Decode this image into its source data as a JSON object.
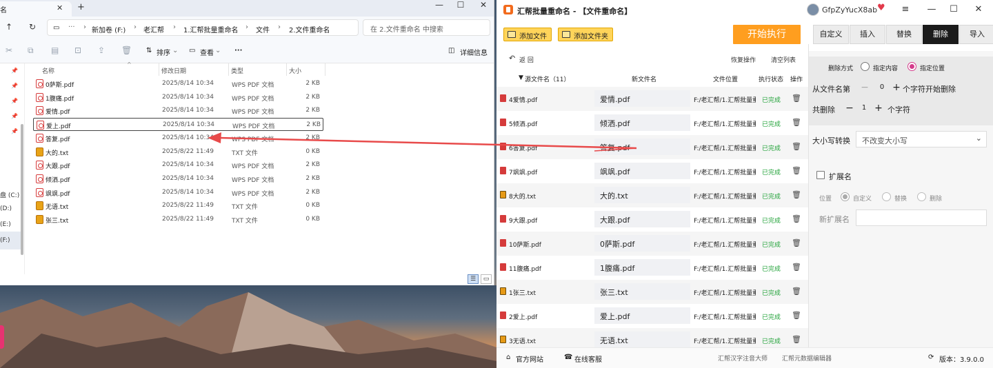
{
  "explorer": {
    "tab_title": "名",
    "crumbs": [
      "新加卷 (F:)",
      "老汇帮",
      "1.汇帮批量重命名",
      "文件",
      "2.文件重命名"
    ],
    "search_placeholder": "在 2.文件重命名 中搜索",
    "toolbar": {
      "sort": "排序",
      "view": "查看",
      "more": "···",
      "details": "详细信息"
    },
    "columns": {
      "name": "名称",
      "date": "修改日期",
      "type": "类型",
      "size": "大小"
    },
    "sidebar": [
      "盘 (C:)",
      "(D:)",
      "(E:)",
      "(F:)"
    ],
    "files": [
      {
        "name": "0萨斯.pdf",
        "date": "2025/8/14 10:34",
        "type": "WPS PDF 文档",
        "size": "2 KB",
        "kind": "pdf"
      },
      {
        "name": "1腹痛.pdf",
        "date": "2025/8/14 10:34",
        "type": "WPS PDF 文档",
        "size": "2 KB",
        "kind": "pdf"
      },
      {
        "name": "爱情.pdf",
        "date": "2025/8/14 10:34",
        "type": "WPS PDF 文档",
        "size": "2 KB",
        "kind": "pdf"
      },
      {
        "name": "爱上.pdf",
        "date": "2025/8/14 10:34",
        "type": "WPS PDF 文档",
        "size": "2 KB",
        "kind": "pdf"
      },
      {
        "name": "答复.pdf",
        "date": "2025/8/14 10:34",
        "type": "WPS PDF 文档",
        "size": "2 KB",
        "kind": "pdf"
      },
      {
        "name": "大的.txt",
        "date": "2025/8/22 11:49",
        "type": "TXT 文件",
        "size": "0 KB",
        "kind": "txt"
      },
      {
        "name": "大跟.pdf",
        "date": "2025/8/14 10:34",
        "type": "WPS PDF 文档",
        "size": "2 KB",
        "kind": "pdf"
      },
      {
        "name": "倾洒.pdf",
        "date": "2025/8/14 10:34",
        "type": "WPS PDF 文档",
        "size": "2 KB",
        "kind": "pdf"
      },
      {
        "name": "飒飒.pdf",
        "date": "2025/8/14 10:34",
        "type": "WPS PDF 文档",
        "size": "2 KB",
        "kind": "pdf"
      },
      {
        "name": "无语.txt",
        "date": "2025/8/22 11:49",
        "type": "TXT 文件",
        "size": "0 KB",
        "kind": "txt"
      },
      {
        "name": "张三.txt",
        "date": "2025/8/22 11:49",
        "type": "TXT 文件",
        "size": "0 KB",
        "kind": "txt"
      }
    ]
  },
  "app": {
    "title": "汇帮批量重命名 - 【文件重命名】",
    "user": "GfpZyYucX8ab",
    "add_file": "添加文件",
    "add_folder": "添加文件夹",
    "start": "开始执行",
    "tabs": [
      "自定义",
      "插入",
      "替换",
      "删除",
      "导入"
    ],
    "back": "返 回",
    "restore": "恢复操作",
    "clear": "清空列表",
    "columns": {
      "src": "源文件名（11）",
      "new": "新文件名",
      "loc": "文件位置",
      "status": "执行状态",
      "op": "操作"
    },
    "rows": [
      {
        "src": "4爱情.pdf",
        "new": "爱情.pdf",
        "loc": "F:/老汇帮/1.汇帮批量重",
        "status": "已完成",
        "kind": "pdf"
      },
      {
        "src": "5倾洒.pdf",
        "new": "倾洒.pdf",
        "loc": "F:/老汇帮/1.汇帮批量重",
        "status": "已完成",
        "kind": "pdf"
      },
      {
        "src": "6答复.pdf",
        "new": "答复.pdf",
        "loc": "F:/老汇帮/1.汇帮批量重",
        "status": "已完成",
        "kind": "pdf"
      },
      {
        "src": "7飒飒.pdf",
        "new": "飒飒.pdf",
        "loc": "F:/老汇帮/1.汇帮批量重",
        "status": "已完成",
        "kind": "pdf"
      },
      {
        "src": "8大的.txt",
        "new": "大的.txt",
        "loc": "F:/老汇帮/1.汇帮批量重",
        "status": "已完成",
        "kind": "txt"
      },
      {
        "src": "9大跟.pdf",
        "new": "大跟.pdf",
        "loc": "F:/老汇帮/1.汇帮批量重",
        "status": "已完成",
        "kind": "pdf"
      },
      {
        "src": "10萨斯.pdf",
        "new": "0萨斯.pdf",
        "loc": "F:/老汇帮/1.汇帮批量重",
        "status": "已完成",
        "kind": "pdf"
      },
      {
        "src": "11腹痛.pdf",
        "new": "1腹痛.pdf",
        "loc": "F:/老汇帮/1.汇帮批量重",
        "status": "已完成",
        "kind": "pdf"
      },
      {
        "src": "1张三.txt",
        "new": "张三.txt",
        "loc": "F:/老汇帮/1.汇帮批量重",
        "status": "已完成",
        "kind": "txt"
      },
      {
        "src": "2爱上.pdf",
        "new": "爱上.pdf",
        "loc": "F:/老汇帮/1.汇帮批量重",
        "status": "已完成",
        "kind": "pdf"
      },
      {
        "src": "3无语.txt",
        "new": "无语.txt",
        "loc": "F:/老汇帮/1.汇帮批量重",
        "status": "已完成",
        "kind": "txt"
      }
    ],
    "panel": {
      "delete_mode_label": "删除方式",
      "opt_content": "指定内容",
      "opt_position": "指定位置",
      "from_label": "从文件名第",
      "from_value": "0",
      "from_suffix": "个字符开始删除",
      "total_label": "共删除",
      "total_value": "1",
      "total_suffix": "个字符",
      "case_label": "大小写转换",
      "case_value": "不改变大小写",
      "ext_label": "扩展名",
      "pos_label": "位置",
      "ext_opt_custom": "自定义",
      "ext_opt_replace": "替换",
      "ext_opt_delete": "删除",
      "new_ext_label": "新扩展名"
    },
    "footer": {
      "site": "官方网站",
      "service": "在线客服",
      "link1": "汇帮汉字注音大师",
      "link2": "汇帮元数据编辑器",
      "version": "版本：3.9.0.0"
    }
  },
  "colors": {
    "accent_orange": "#ff9e1f",
    "done_green": "#24a33b",
    "radio_pink": "#d43a8b",
    "arrow_red": "#e84a4a"
  }
}
